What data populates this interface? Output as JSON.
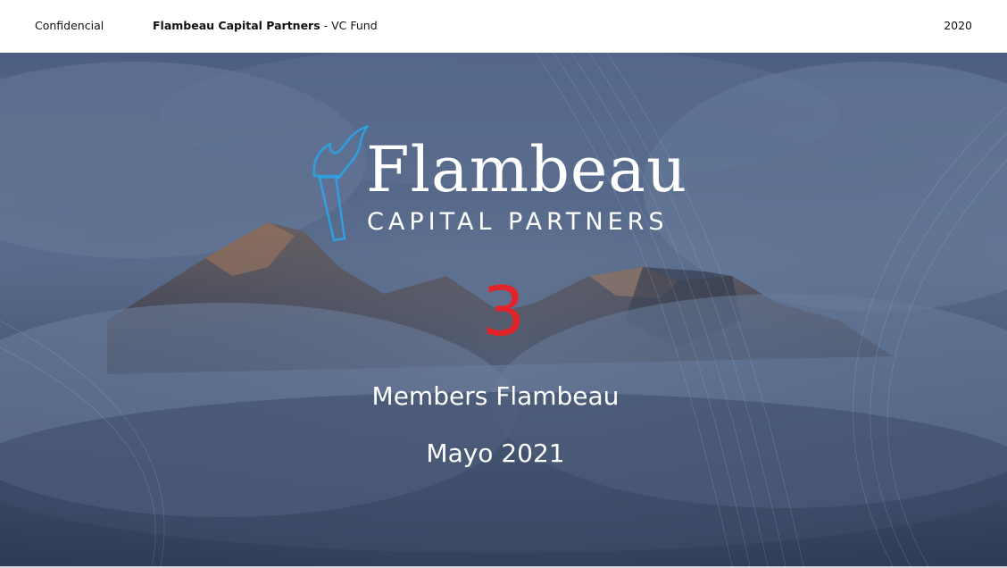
{
  "header": {
    "confidential": "Confidencial",
    "company_bold": "Flambeau Capital Partners",
    "company_suffix": " - VC Fund",
    "year": "2020"
  },
  "logo": {
    "name": "Flambeau",
    "tagline": "CAPITAL PARTNERS",
    "icon": "torch-icon",
    "icon_color": "#2f9fe0"
  },
  "slide": {
    "number": "3",
    "number_color": "#e3232a",
    "title": "Members Flambeau",
    "date": "Mayo 2021"
  }
}
